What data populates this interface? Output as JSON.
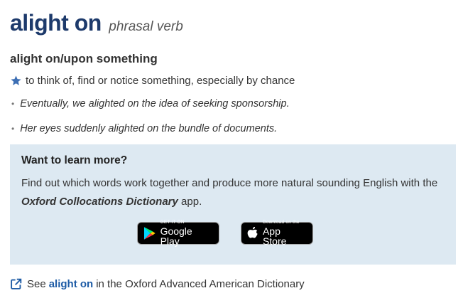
{
  "entry": {
    "headword": "alight on",
    "part_of_speech": "phrasal verb",
    "phrase": "alight on/upon something",
    "sense": "to think of, find or notice something, especially by chance",
    "examples": [
      "Eventually, we alighted on the idea of seeking sponsorship.",
      "Her eyes suddenly alighted on the bundle of documents."
    ]
  },
  "promo": {
    "title": "Want to learn more?",
    "text_before": "Find out which words work together and produce more natural sounding English with the ",
    "dictionary_name": "Oxford Collocations Dictionary",
    "text_after": " app.",
    "google_play": {
      "small": "GET IT ON",
      "big": "Google Play"
    },
    "app_store": {
      "small": "Download on the",
      "big": "App Store"
    }
  },
  "see_also": {
    "prefix": "See",
    "link": "alight on",
    "suffix": "in the Oxford Advanced American Dictionary"
  },
  "colors": {
    "headword": "#1d3a6b",
    "link": "#1d5ba5",
    "promo_bg": "#dde9f2",
    "star": "#3d6fb4"
  }
}
